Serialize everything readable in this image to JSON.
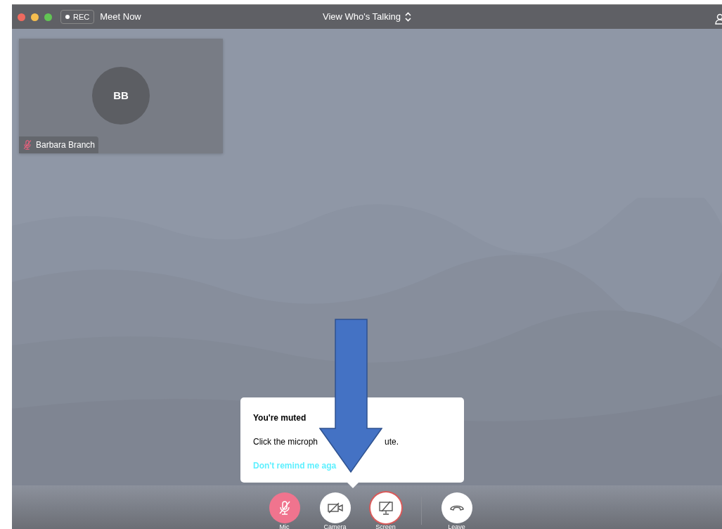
{
  "window": {
    "traffic_lights": [
      {
        "color": "#ee6a5f"
      },
      {
        "color": "#f5be4f"
      },
      {
        "color": "#62c554"
      }
    ],
    "rec_button": "REC",
    "title": "Meet Now",
    "view_selector": "View Who's Talking"
  },
  "participants": [
    {
      "initials": "BB",
      "name": "Barbara Branch",
      "muted": true
    }
  ],
  "popup": {
    "title": "You're muted",
    "message_parts": [
      "Click the microph",
      "ute."
    ],
    "link": "Don't remind me aga"
  },
  "controls": [
    {
      "kind": "mic",
      "label": "Mic",
      "muted": true,
      "highlighted": false
    },
    {
      "kind": "camera",
      "label": "Camera",
      "muted": false,
      "highlighted": false
    },
    {
      "kind": "screen",
      "label": "Screen",
      "muted": false,
      "highlighted": true
    },
    {
      "kind": "leave",
      "label": "Leave",
      "muted": false,
      "highlighted": false
    }
  ]
}
